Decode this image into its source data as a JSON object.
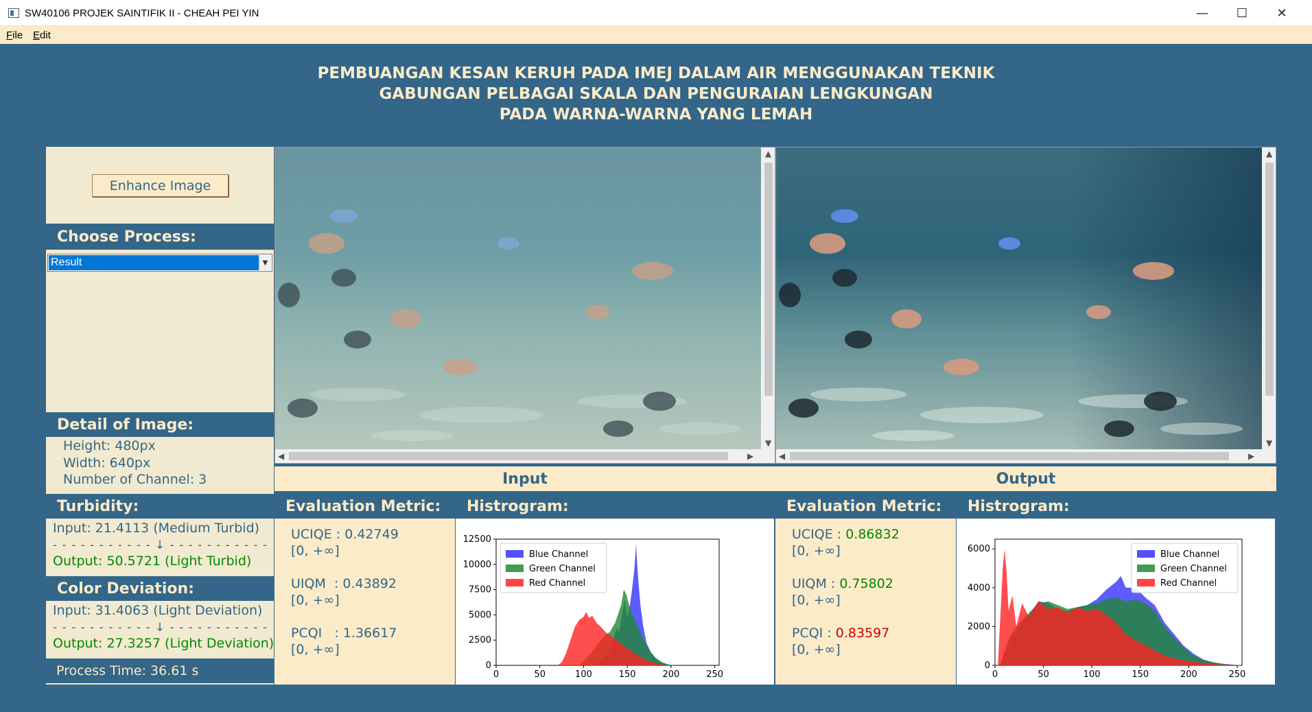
{
  "window": {
    "title": "SW40106 PROJEK SAINTIFIK II - CHEAH PEI YIN",
    "minimize": "—",
    "maximize": "☐",
    "close": "✕"
  },
  "menu": {
    "file_ul": "F",
    "file_rest": "ile",
    "edit_ul": "E",
    "edit_rest": "dit"
  },
  "heading": {
    "line1": "PEMBUANGAN KESAN KERUH PADA IMEJ DALAM AIR MENGGUNAKAN TEKNIK",
    "line2": "GABUNGAN PELBAGAI SKALA DAN PENGURAIAN LENGKUNGAN",
    "line3": "PADA WARNA-WARNA YANG LEMAH"
  },
  "controls": {
    "enhance_button": "Enhance Image",
    "choose_process_title": "Choose Process:",
    "process_selected": "Result"
  },
  "details": {
    "title": "Detail of Image:",
    "height": "Height: 480px",
    "width": "Width: 640px",
    "channels": "Number of Channel: 3"
  },
  "turbidity": {
    "title": "Turbidity:",
    "input": "Input: 21.4113 (Medium Turbid)",
    "divider": "- - - - - - - - - - - ↓ - - - - - - - - - - -",
    "output": "Output: 50.5721 (Light Turbid)"
  },
  "color_deviation": {
    "title": "Color Deviation:",
    "input": "Input: 31.4063 (Light Deviation)",
    "divider": "- - - - - - - - - - - ↓ - - - - - - - - - - -",
    "output": "Output: 27.3257 (Light Deviation)"
  },
  "process_time": "Process Time: 36.61 s",
  "input_panel": {
    "label": "Input",
    "metric_title": "Evaluation Metric:",
    "uciqe_label": "UCIQE : ",
    "uciqe_value": "0.42749",
    "uiqm_label": "UIQM  : ",
    "uiqm_value": "0.43892",
    "pcqi_label": "PCQI   : ",
    "pcqi_value": "1.36617",
    "range": "[0, +∞]",
    "hist_title": "Histrogram:"
  },
  "output_panel": {
    "label": "Output",
    "metric_title": "Evaluation Metric:",
    "uciqe_label": "UCIQE : ",
    "uciqe_value": "0.86832",
    "uiqm_label": "UIQM : ",
    "uiqm_value": "0.75802",
    "pcqi_label": "PCQI : ",
    "pcqi_value": "0.83597",
    "range": "[0, +∞]",
    "hist_title": "Histrogram:"
  },
  "colors": {
    "background": "#336688",
    "cream": "#fcebc9",
    "good": "#008800",
    "bad": "#cc0000",
    "blue_channel": "#3333ff",
    "green_channel": "#228833",
    "red_channel": "#ff2222"
  },
  "chart_data": [
    {
      "type": "area",
      "xlim": [
        0,
        255
      ],
      "ylim": [
        0,
        12500
      ],
      "x_ticks": [
        0,
        50,
        100,
        150,
        200,
        250
      ],
      "y_ticks": [
        0,
        2500,
        5000,
        7500,
        10000,
        12500
      ],
      "legend_position": "top-left",
      "series": [
        {
          "name": "Blue Channel",
          "color": "#3333ff",
          "points": [
            [
              112,
              0
            ],
            [
              118,
              400
            ],
            [
              124,
              900
            ],
            [
              130,
              1500
            ],
            [
              134,
              2500
            ],
            [
              138,
              3800
            ],
            [
              140,
              3200
            ],
            [
              143,
              4500
            ],
            [
              147,
              6500
            ],
            [
              150,
              4800
            ],
            [
              153,
              6000
            ],
            [
              155,
              7200
            ],
            [
              158,
              9500
            ],
            [
              160,
              12000
            ],
            [
              162,
              9000
            ],
            [
              165,
              6000
            ],
            [
              168,
              4000
            ],
            [
              172,
              2200
            ],
            [
              178,
              1100
            ],
            [
              185,
              400
            ],
            [
              195,
              100
            ],
            [
              205,
              0
            ]
          ]
        },
        {
          "name": "Green Channel",
          "color": "#228833",
          "points": [
            [
              95,
              0
            ],
            [
              102,
              600
            ],
            [
              110,
              1400
            ],
            [
              118,
              2300
            ],
            [
              125,
              3000
            ],
            [
              130,
              3300
            ],
            [
              136,
              4200
            ],
            [
              140,
              5200
            ],
            [
              143,
              6000
            ],
            [
              146,
              7500
            ],
            [
              149,
              7000
            ],
            [
              152,
              6000
            ],
            [
              155,
              5200
            ],
            [
              160,
              4300
            ],
            [
              165,
              3200
            ],
            [
              170,
              2300
            ],
            [
              176,
              1400
            ],
            [
              182,
              800
            ],
            [
              190,
              300
            ],
            [
              200,
              0
            ]
          ]
        },
        {
          "name": "Red Channel",
          "color": "#ff2222",
          "points": [
            [
              70,
              0
            ],
            [
              75,
              300
            ],
            [
              80,
              1200
            ],
            [
              85,
              2500
            ],
            [
              90,
              3800
            ],
            [
              95,
              4500
            ],
            [
              100,
              4800
            ],
            [
              103,
              5300
            ],
            [
              106,
              4700
            ],
            [
              110,
              4900
            ],
            [
              115,
              4200
            ],
            [
              120,
              3800
            ],
            [
              125,
              3300
            ],
            [
              130,
              3000
            ],
            [
              136,
              2600
            ],
            [
              142,
              2200
            ],
            [
              150,
              1700
            ],
            [
              158,
              1200
            ],
            [
              166,
              800
            ],
            [
              175,
              400
            ],
            [
              185,
              150
            ],
            [
              195,
              0
            ]
          ]
        }
      ]
    },
    {
      "type": "area",
      "xlim": [
        0,
        255
      ],
      "ylim": [
        0,
        6500
      ],
      "x_ticks": [
        0,
        50,
        100,
        150,
        200,
        250
      ],
      "y_ticks": [
        0,
        2000,
        4000,
        6000
      ],
      "legend_position": "top-right",
      "series": [
        {
          "name": "Blue Channel",
          "color": "#3333ff",
          "points": [
            [
              5,
              0
            ],
            [
              15,
              1200
            ],
            [
              25,
              2000
            ],
            [
              35,
              2600
            ],
            [
              45,
              3300
            ],
            [
              55,
              3200
            ],
            [
              65,
              2900
            ],
            [
              75,
              2800
            ],
            [
              85,
              3000
            ],
            [
              95,
              3100
            ],
            [
              105,
              3400
            ],
            [
              115,
              3900
            ],
            [
              125,
              4300
            ],
            [
              130,
              4600
            ],
            [
              135,
              4000
            ],
            [
              145,
              4000
            ],
            [
              155,
              3500
            ],
            [
              165,
              3100
            ],
            [
              175,
              2200
            ],
            [
              185,
              1600
            ],
            [
              195,
              1000
            ],
            [
              205,
              600
            ],
            [
              215,
              300
            ],
            [
              230,
              100
            ],
            [
              255,
              0
            ]
          ]
        },
        {
          "name": "Green Channel",
          "color": "#228833",
          "points": [
            [
              5,
              0
            ],
            [
              15,
              1500
            ],
            [
              25,
              2200
            ],
            [
              35,
              2700
            ],
            [
              45,
              3200
            ],
            [
              55,
              3300
            ],
            [
              65,
              3100
            ],
            [
              75,
              2900
            ],
            [
              85,
              3000
            ],
            [
              95,
              3100
            ],
            [
              105,
              3200
            ],
            [
              115,
              3400
            ],
            [
              125,
              3500
            ],
            [
              135,
              3300
            ],
            [
              145,
              3400
            ],
            [
              155,
              3200
            ],
            [
              165,
              2800
            ],
            [
              175,
              2000
            ],
            [
              185,
              1400
            ],
            [
              195,
              900
            ],
            [
              205,
              500
            ],
            [
              220,
              200
            ],
            [
              240,
              50
            ],
            [
              255,
              0
            ]
          ]
        },
        {
          "name": "Red Channel",
          "color": "#ff2222",
          "points": [
            [
              3,
              0
            ],
            [
              6,
              3000
            ],
            [
              8,
              5000
            ],
            [
              10,
              6000
            ],
            [
              12,
              4800
            ],
            [
              14,
              2800
            ],
            [
              18,
              3600
            ],
            [
              22,
              2000
            ],
            [
              28,
              3200
            ],
            [
              35,
              2500
            ],
            [
              45,
              3300
            ],
            [
              55,
              2900
            ],
            [
              65,
              3000
            ],
            [
              75,
              2700
            ],
            [
              85,
              3000
            ],
            [
              95,
              2800
            ],
            [
              105,
              2900
            ],
            [
              115,
              2600
            ],
            [
              125,
              2200
            ],
            [
              135,
              1600
            ],
            [
              145,
              1300
            ],
            [
              160,
              900
            ],
            [
              175,
              500
            ],
            [
              190,
              300
            ],
            [
              210,
              150
            ],
            [
              230,
              50
            ],
            [
              250,
              0
            ]
          ]
        }
      ]
    }
  ]
}
